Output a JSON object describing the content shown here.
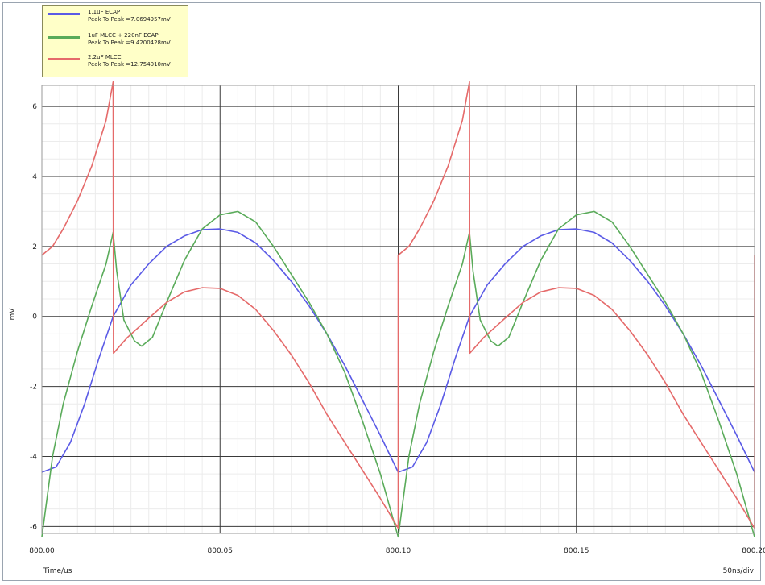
{
  "chart_data": {
    "type": "line",
    "xlabel": "Time/us",
    "ylabel": "mV",
    "x_scale_note": "50ns/div",
    "xlim": [
      800.0,
      800.2
    ],
    "ylim": [
      -6.2,
      6.6
    ],
    "x_ticks": [
      "800.00",
      "800.05",
      "800.10",
      "800.15",
      "800.20"
    ],
    "y_ticks": [
      "6",
      "4",
      "2",
      "0",
      "-2",
      "-4",
      "-6"
    ],
    "grid": true,
    "legend_position": "top-left",
    "series": [
      {
        "name": "1.1uF ECAP",
        "peak_label": "Peak To Peak =7.0694957mV",
        "color": "#5a5ae6",
        "period_points": [
          [
            0.0,
            -4.45
          ],
          [
            0.004,
            -4.3
          ],
          [
            0.008,
            -3.6
          ],
          [
            0.012,
            -2.5
          ],
          [
            0.016,
            -1.2
          ],
          [
            0.02,
            0.0
          ],
          [
            0.025,
            0.9
          ],
          [
            0.03,
            1.5
          ],
          [
            0.035,
            2.0
          ],
          [
            0.04,
            2.3
          ],
          [
            0.045,
            2.48
          ],
          [
            0.05,
            2.5
          ],
          [
            0.055,
            2.4
          ],
          [
            0.06,
            2.1
          ],
          [
            0.065,
            1.6
          ],
          [
            0.07,
            1.0
          ],
          [
            0.075,
            0.3
          ],
          [
            0.08,
            -0.5
          ],
          [
            0.085,
            -1.4
          ],
          [
            0.09,
            -2.4
          ],
          [
            0.095,
            -3.4
          ],
          [
            0.1,
            -4.45
          ]
        ]
      },
      {
        "name": "1uF MLCC + 220nF ECAP",
        "peak_label": "Peak To Peak =9.4200428mV",
        "color": "#5aab5a",
        "period_points": [
          [
            0.0,
            -6.3
          ],
          [
            0.003,
            -4.0
          ],
          [
            0.006,
            -2.5
          ],
          [
            0.01,
            -1.0
          ],
          [
            0.014,
            0.3
          ],
          [
            0.018,
            1.5
          ],
          [
            0.02,
            2.4
          ],
          [
            0.021,
            1.3
          ],
          [
            0.023,
            -0.1
          ],
          [
            0.026,
            -0.7
          ],
          [
            0.028,
            -0.85
          ],
          [
            0.031,
            -0.6
          ],
          [
            0.035,
            0.4
          ],
          [
            0.04,
            1.6
          ],
          [
            0.045,
            2.5
          ],
          [
            0.05,
            2.9
          ],
          [
            0.055,
            3.0
          ],
          [
            0.06,
            2.7
          ],
          [
            0.065,
            2.0
          ],
          [
            0.07,
            1.2
          ],
          [
            0.075,
            0.4
          ],
          [
            0.08,
            -0.5
          ],
          [
            0.085,
            -1.6
          ],
          [
            0.09,
            -3.0
          ],
          [
            0.095,
            -4.5
          ],
          [
            0.1,
            -6.3
          ]
        ]
      },
      {
        "name": "2.2uF MLCC",
        "peak_label": "Peak To Peak =12.754010mV",
        "color": "#e56a6a",
        "period_points": [
          [
            0.0,
            1.75
          ],
          [
            0.003,
            2.0
          ],
          [
            0.006,
            2.5
          ],
          [
            0.01,
            3.3
          ],
          [
            0.014,
            4.3
          ],
          [
            0.018,
            5.6
          ],
          [
            0.02,
            6.7
          ],
          [
            0.0201,
            -1.05
          ],
          [
            0.024,
            -0.6
          ],
          [
            0.03,
            -0.05
          ],
          [
            0.035,
            0.4
          ],
          [
            0.04,
            0.7
          ],
          [
            0.045,
            0.82
          ],
          [
            0.05,
            0.8
          ],
          [
            0.055,
            0.6
          ],
          [
            0.06,
            0.2
          ],
          [
            0.065,
            -0.4
          ],
          [
            0.07,
            -1.1
          ],
          [
            0.075,
            -1.9
          ],
          [
            0.08,
            -2.8
          ],
          [
            0.085,
            -3.6
          ],
          [
            0.09,
            -4.4
          ],
          [
            0.095,
            -5.2
          ],
          [
            0.1,
            -6.05
          ]
        ]
      }
    ]
  }
}
